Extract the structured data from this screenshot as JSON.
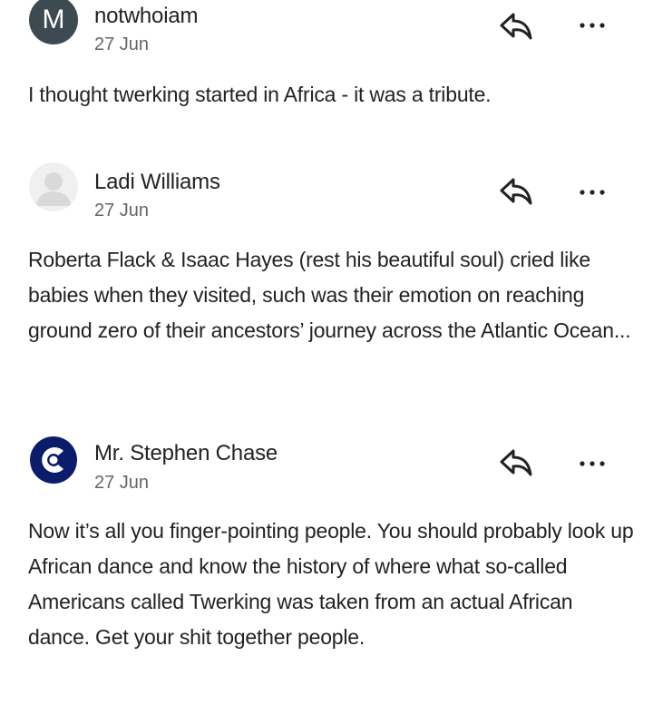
{
  "comments": [
    {
      "author": "notwhoiam",
      "avatar_letter": "M",
      "avatar_type": "letter",
      "date": "27 Jun",
      "text": "I thought twerking started in Africa - it was a tribute."
    },
    {
      "author": "Ladi Williams",
      "avatar_type": "default-person",
      "date": "27 Jun",
      "text": "Roberta Flack & Isaac Hayes (rest his beautiful soul) cried like babies when they visited, such was their emotion on reaching ground zero of their ancestors’ journey across the Atlantic Ocean..."
    },
    {
      "author": "Mr. Stephen Chase",
      "avatar_type": "logo",
      "date": "27 Jun",
      "text": "Now it’s all you finger-pointing people. You should probably look up African dance and know the history of where what so-called Americans called Twerking was taken from an actual African dance. Get your shit together people."
    }
  ],
  "icons": {
    "reply": "reply-arrow-icon",
    "more": "more-options-icon"
  },
  "colors": {
    "avatar_letter_bg": "#3e4a52",
    "logo_blue": "#0b1c6b",
    "text": "#222222",
    "meta": "#666666"
  }
}
